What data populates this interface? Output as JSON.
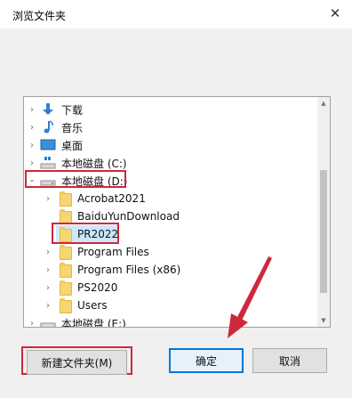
{
  "dialog": {
    "title": "浏览文件夹",
    "close_glyph": "✕"
  },
  "tree": {
    "items": [
      {
        "label": "下载",
        "icon": "download-arrow-icon"
      },
      {
        "label": "音乐",
        "icon": "music-note-icon"
      },
      {
        "label": "桌面",
        "icon": "desktop-icon"
      },
      {
        "label": "本地磁盘 (C:)",
        "icon": "drive-icon"
      },
      {
        "label": "本地磁盘 (D:)",
        "icon": "drive-icon",
        "expanded": true
      },
      {
        "label": "Acrobat2021",
        "icon": "folder-icon"
      },
      {
        "label": "BaiduYunDownload",
        "icon": "folder-icon"
      },
      {
        "label": "PR2022",
        "icon": "folder-icon",
        "selected": true
      },
      {
        "label": "Program Files",
        "icon": "folder-icon"
      },
      {
        "label": "Program Files (x86)",
        "icon": "folder-icon"
      },
      {
        "label": "PS2020",
        "icon": "folder-icon"
      },
      {
        "label": "Users",
        "icon": "folder-icon"
      },
      {
        "label": "本地磁盘 (E:)",
        "icon": "drive-icon"
      }
    ]
  },
  "buttons": {
    "new_folder": "新建文件夹(M)",
    "ok": "确定",
    "cancel": "取消"
  },
  "colors": {
    "highlight_red": "#d0273a",
    "selection_blue": "#cce8ff",
    "accent_blue": "#0078d7"
  }
}
